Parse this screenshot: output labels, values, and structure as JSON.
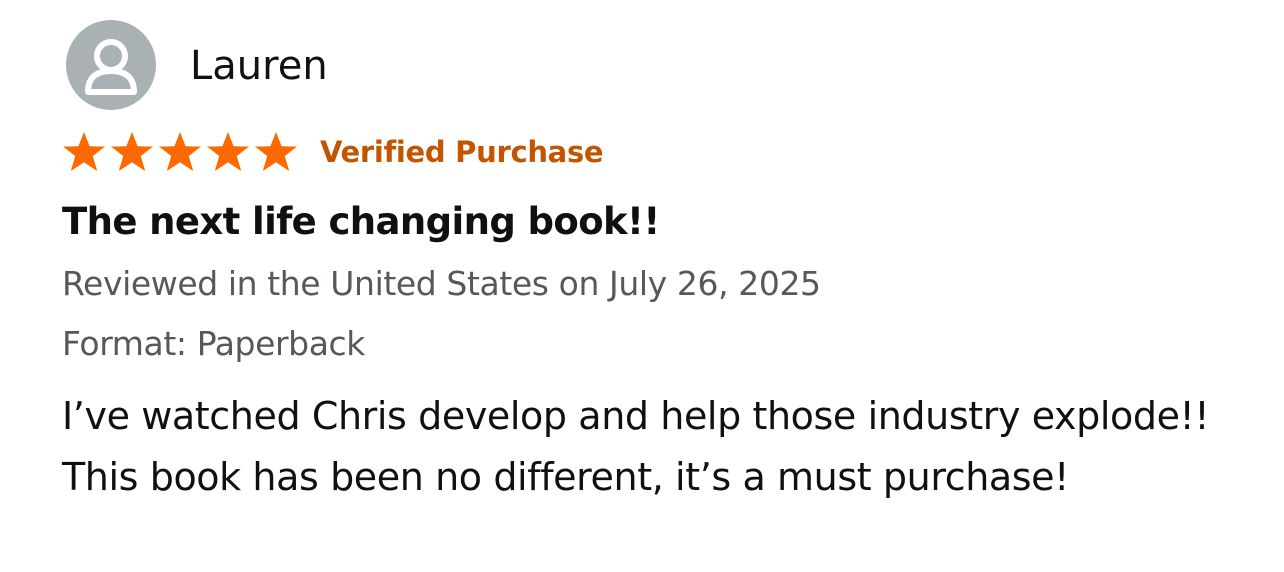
{
  "reviewer": {
    "name": "Lauren",
    "avatar_icon": "default-user-icon"
  },
  "rating": {
    "stars": 5,
    "max_stars": 5,
    "star_color": "#ff6a00",
    "badge": "Verified Purchase",
    "badge_color": "#c45500"
  },
  "review": {
    "title": "The next life changing book!!",
    "date_line": "Reviewed in the United States on July 26, 2025",
    "format_line": "Format: Paperback",
    "body": "I’ve watched Chris develop and help those industry explode!! This book has been no different, it’s a must purchase!"
  }
}
